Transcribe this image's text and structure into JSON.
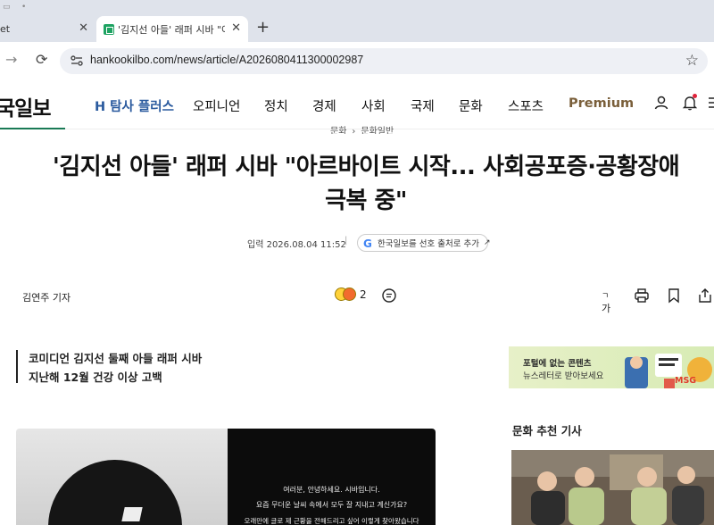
{
  "browser": {
    "tabs": [
      {
        "label": "et",
        "active": false
      },
      {
        "label": "'김지선 아들' 래퍼 시바 \"아르바이트",
        "active": true
      }
    ],
    "url": "hankookilbo.com/news/article/A2026080411300002987"
  },
  "site": {
    "logo": "국일보",
    "nav": [
      "H 탐사 플러스",
      "오피니언",
      "정치",
      "경제",
      "사회",
      "국제",
      "문화",
      "스포츠",
      "Premium"
    ]
  },
  "article": {
    "breadcrumb": {
      "section": "문화",
      "sub": "문화일반"
    },
    "headline_line1": "'김지선 아들' 래퍼 시바 \"아르바이트 시작... 사회공포증·공황장애",
    "headline_line2": "극복 중\"",
    "date": "입력 2026.08.04 11:52",
    "google_button": "한국일보를 선호 출처로 추가",
    "reporter": "김연주 기자",
    "reaction_count": "2",
    "font_size_label": "가",
    "summary": [
      "코미디언 김지선 둘째 아들 래퍼 시바",
      "지난해 12월 건강 이상 고백"
    ],
    "photo_text": [
      "여러분, 안녕하세요. 시바입니다.",
      "요즘 무더운 날씨 속에서 모두 잘 지내고 계신가요?",
      "오래만에 글로 제 근황을 전해드리고 싶어 이렇게 찾아왔습니다"
    ]
  },
  "sidebar": {
    "ad_line1": "포털에 없는 콘텐츠",
    "ad_line2": "뉴스레터로 받아보세요",
    "ad_badge": "MSG",
    "rec_title": "문화 추천 기사"
  },
  "colors": {
    "accent_green": "#1a7a56",
    "tam_blue": "#2a5a9e",
    "premium": "#7a5f3a",
    "notif": "#e0223a"
  }
}
